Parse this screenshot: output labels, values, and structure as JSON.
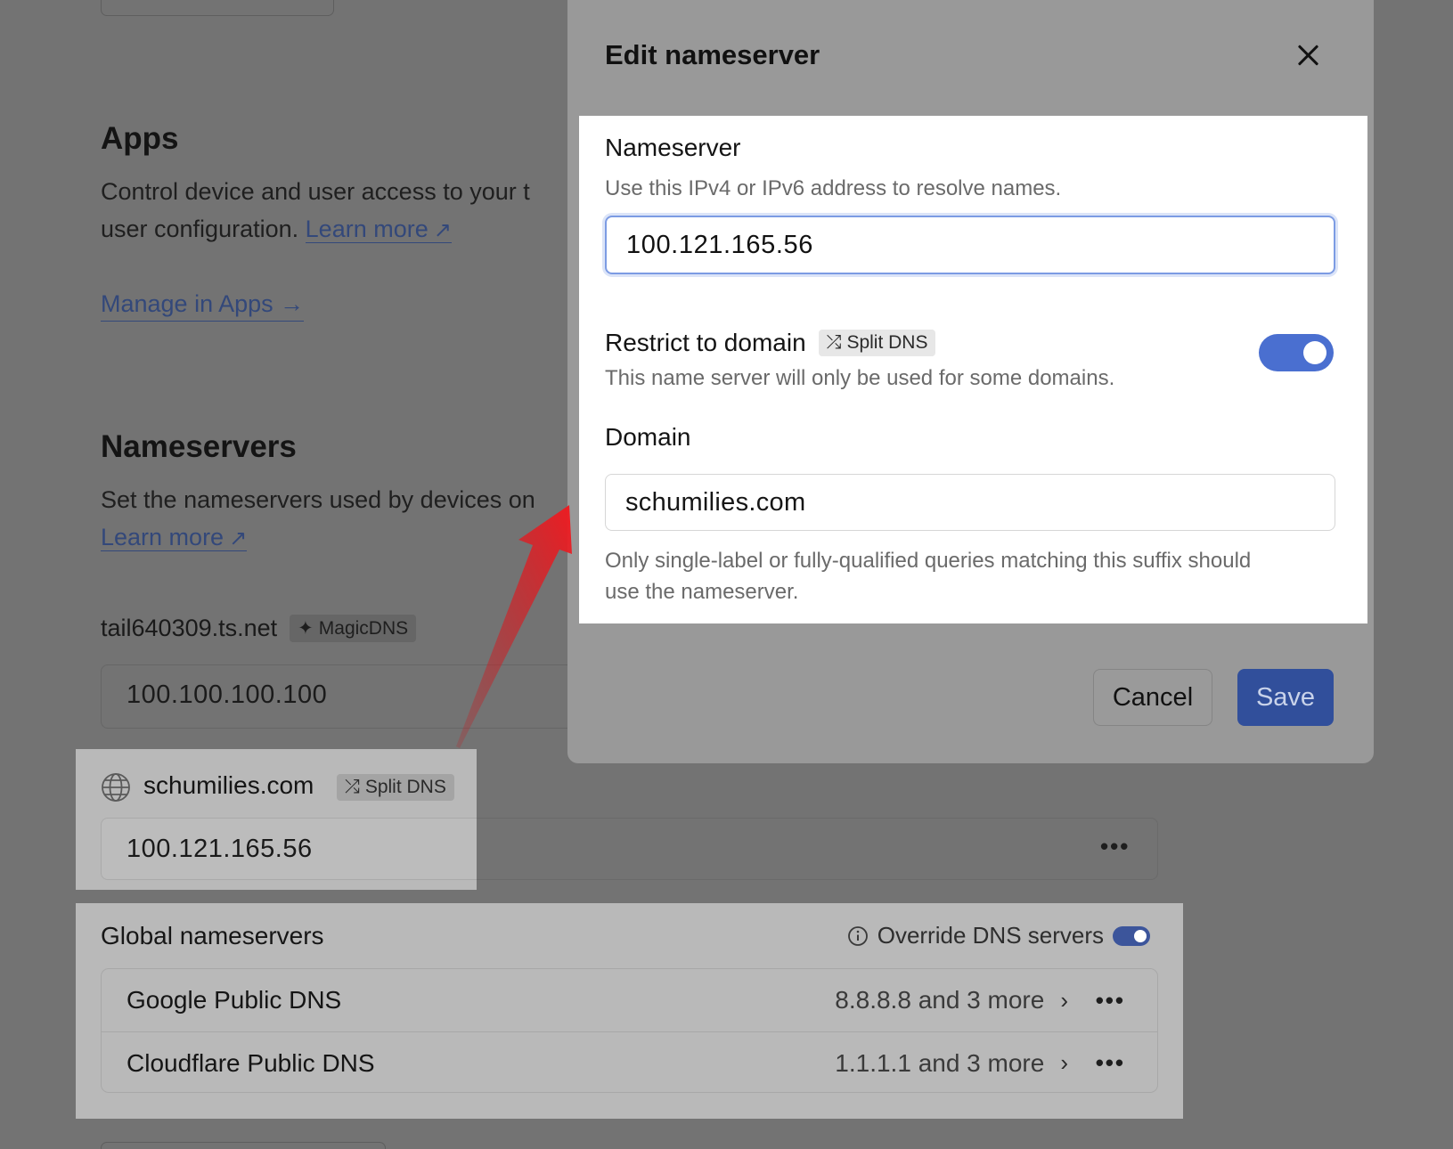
{
  "background": {
    "apps": {
      "heading": "Apps",
      "desc_line1": "Control device and user access to your t",
      "desc_line2": "user configuration.",
      "learn_more": "Learn more",
      "manage": "Manage in Apps",
      "manage_arrow": "→"
    },
    "nameservers": {
      "heading": "Nameservers",
      "desc_line1": "Set the nameservers used by devices on",
      "learn_more": "Learn more"
    },
    "tailnet": {
      "name": "tail640309.ts.net",
      "tag": "MagicDNS",
      "value": "100.100.100.100"
    },
    "split_dns": {
      "domain": "schumilies.com",
      "tag": "Split DNS",
      "value": "100.121.165.56",
      "more": "•••"
    },
    "global": {
      "title": "Global nameservers",
      "override_label": "Override DNS servers",
      "override_enabled": true,
      "rows": [
        {
          "name": "Google Public DNS",
          "value": "8.8.8.8 and 3 more",
          "more": "•••"
        },
        {
          "name": "Cloudflare Public DNS",
          "value": "1.1.1.1 and 3 more",
          "more": "•••"
        }
      ]
    }
  },
  "modal": {
    "title": "Edit nameserver",
    "nameserver_label": "Nameserver",
    "nameserver_hint": "Use this IPv4 or IPv6 address to resolve names.",
    "nameserver_value": "100.121.165.56",
    "restrict_label": "Restrict to domain",
    "restrict_tag": "Split DNS",
    "restrict_hint": "This name server will only be used for some domains.",
    "restrict_enabled": true,
    "domain_label": "Domain",
    "domain_value": "schumilies.com",
    "domain_hint_line1": "Only single-label or fully-qualified queries matching this suffix should",
    "domain_hint_line2": "use the nameserver.",
    "cancel_label": "Cancel",
    "save_label": "Save"
  },
  "colors": {
    "overlay": "#737373",
    "modal": "#999999",
    "panel": "#ffffff",
    "toggle_on": "#4a6fd0",
    "save_button": "#314f9b",
    "annotation_arrow": "#e3121a"
  }
}
